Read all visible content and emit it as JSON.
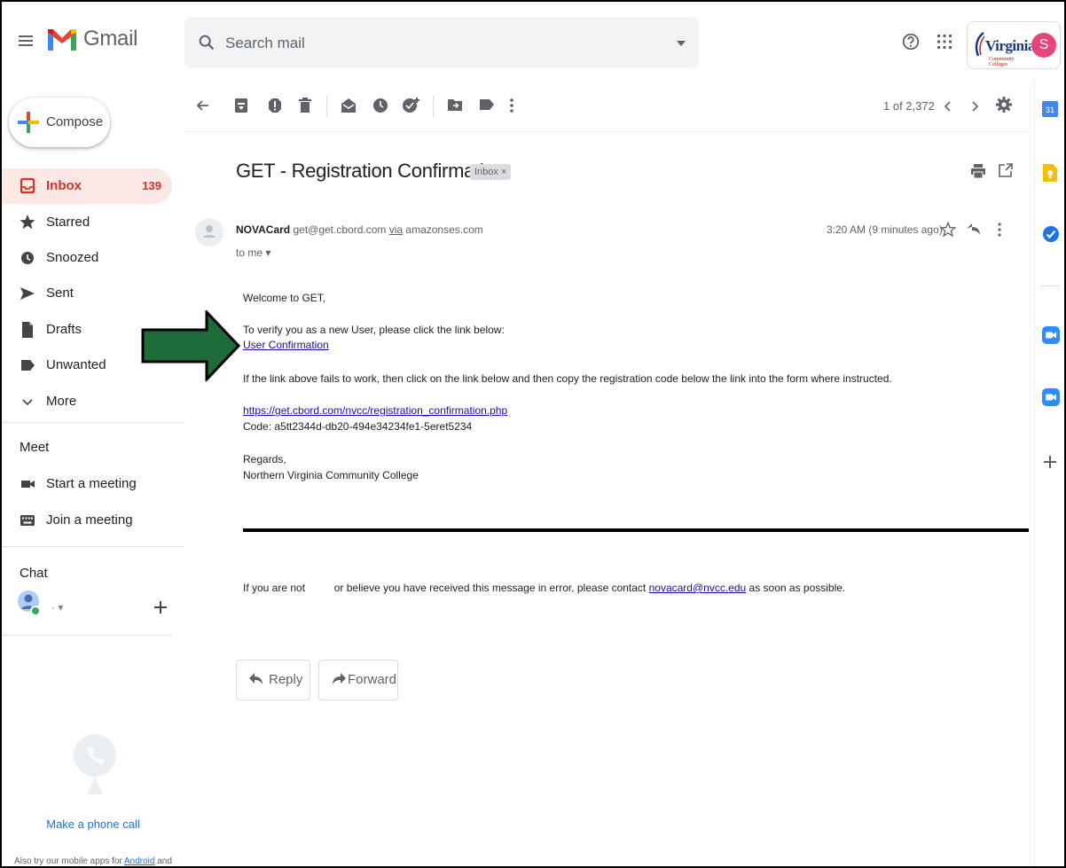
{
  "header": {
    "app_name": "Gmail",
    "search_placeholder": "Search mail",
    "org_name": "Virginia's",
    "org_sub": "Community Colleges",
    "avatar_letter": "S"
  },
  "sidebar": {
    "compose": "Compose",
    "items": [
      {
        "label": "Inbox",
        "count": "139"
      },
      {
        "label": "Starred"
      },
      {
        "label": "Snoozed"
      },
      {
        "label": "Sent"
      },
      {
        "label": "Drafts"
      },
      {
        "label": "Unwanted"
      },
      {
        "label": "More"
      }
    ],
    "meet_title": "Meet",
    "meet_items": [
      {
        "label": "Start a meeting"
      },
      {
        "label": "Join a meeting"
      }
    ],
    "chat_title": "Chat",
    "chat_user_name": "·  ▾",
    "phone_link": "Make a phone call",
    "apps_note_prefix": "Also try our mobile apps for ",
    "apps_note_link": "Android",
    "apps_note_suffix": " and"
  },
  "toolbar": {
    "pager": "1 of 2,372"
  },
  "email": {
    "subject": "GET - Registration Confirmation",
    "label_chip": "Inbox ×",
    "sender_name": "NOVACard",
    "sender_email": "get@get.cbord.com",
    "via_word": "via",
    "via_domain": "amazonses.com",
    "to": "to me ▾",
    "time": "3:20 AM (9 minutes ago)",
    "greeting": "Welcome to GET,",
    "verify_line": "To verify you as a new User, please click the link below:",
    "confirm_link": "User Confirmation",
    "fallback_line": "If the link above fails to work, then click on the link below and then copy the registration code below the link into the form where instructed.",
    "url": "https://get.cbord.com/nvcc/registration_confirmation.php",
    "code": "Code: a5tt2344d-db20-494e34234fe1-5eret5234",
    "regards": "Regards,",
    "signature": "Northern Virginia Community College",
    "footer_prefix": "If you are not",
    "footer_middle": "or believe you have received this message in error, please contact",
    "footer_email": "novacard@nvcc.edu",
    "footer_suffix": "as soon as possible."
  },
  "actions": {
    "reply": "Reply",
    "forward": "Forward"
  },
  "rail": {
    "calendar_day": "31"
  },
  "colors": {
    "annotation_arrow": "#1e6b3a",
    "inbox_active_bg": "#fce8e6",
    "inbox_active_text": "#d93025",
    "link": "#1a0dab"
  }
}
